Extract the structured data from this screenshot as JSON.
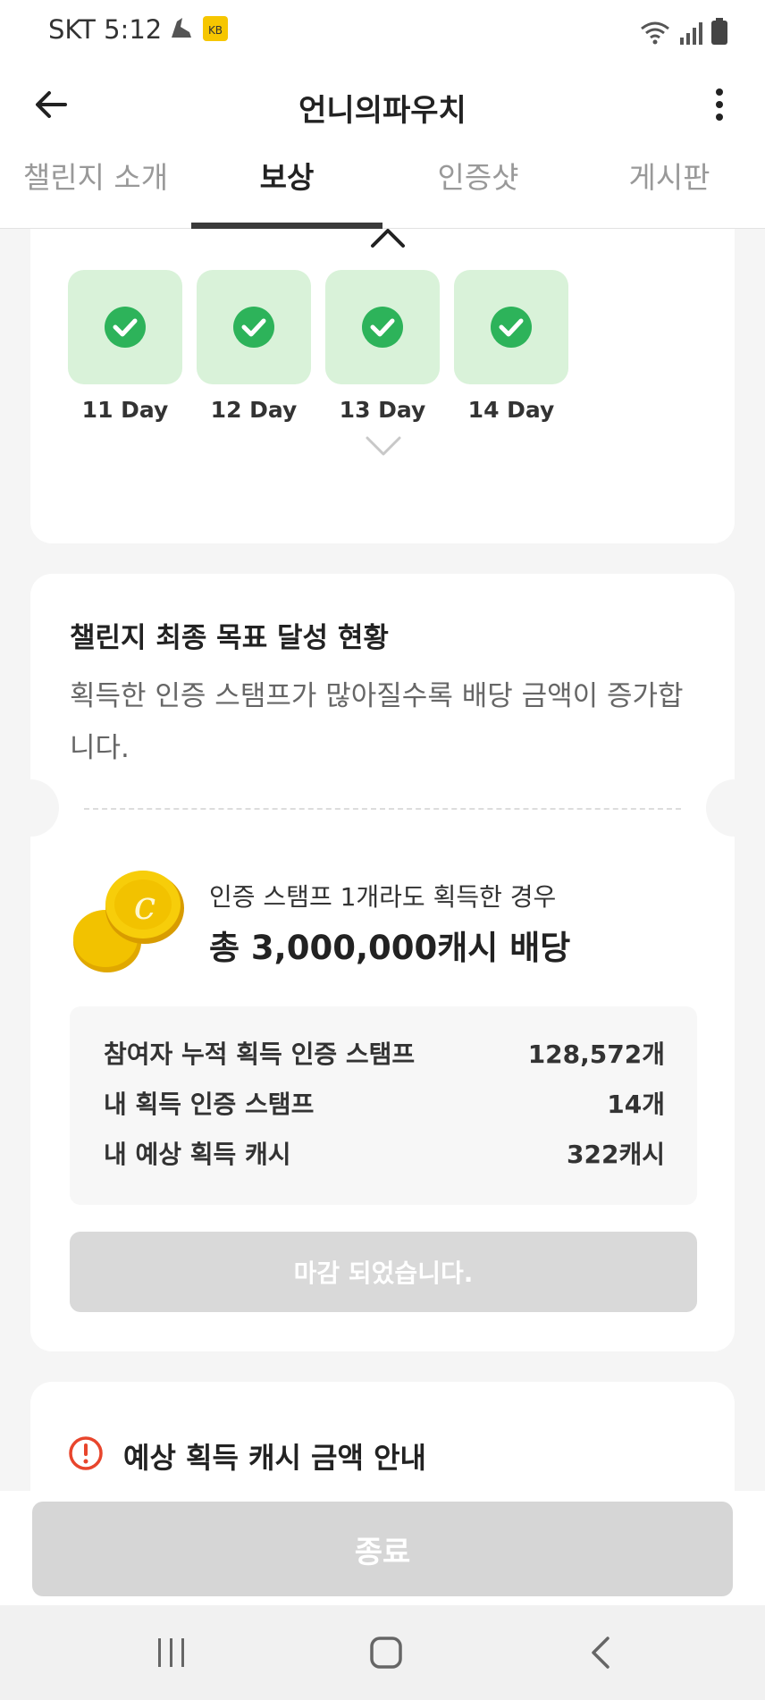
{
  "status_bar": {
    "time": "SKT 5:12",
    "icons": [
      "shoe-icon",
      "kb-app-icon",
      "wifi-icon",
      "signal-icon",
      "battery-icon"
    ]
  },
  "app_bar": {
    "title": "언니의파우치",
    "back_icon": "back-arrow-icon",
    "menu_icon": "more-vert-icon"
  },
  "tabs": [
    {
      "label": "챌린지 소개",
      "active": false
    },
    {
      "label": "보상",
      "active": true
    },
    {
      "label": "인증샷",
      "active": false
    },
    {
      "label": "게시판",
      "active": false
    }
  ],
  "stamps": {
    "days": [
      {
        "label": "11 Day",
        "done": true
      },
      {
        "label": "12 Day",
        "done": true
      },
      {
        "label": "13 Day",
        "done": true
      },
      {
        "label": "14 Day",
        "done": true
      }
    ],
    "done_color": "#2db35a",
    "box_color": "#d9f2d9"
  },
  "goal": {
    "title": "챌린지 최종 목표 달성 현황",
    "description": "획득한 인증 스탬프가 많아질수록 배당 금액이 증가합니다.",
    "reward_condition": "인증 스탬프 1개라도 획득한 경우",
    "reward_amount": "총 3,000,000캐시 배당",
    "stats": [
      {
        "label": "참여자 누적 획득 인증 스탬프",
        "value": "128,572개"
      },
      {
        "label": "내 획득 인증 스탬프",
        "value": "14개"
      },
      {
        "label": "내 예상 획득 캐시",
        "value": "322캐시"
      }
    ],
    "closed_button": "마감 되었습니다."
  },
  "notice": {
    "title": "예상 획득 캐시 금액 안내",
    "icon": "warning-icon"
  },
  "footer": {
    "end_button": "종료"
  },
  "nav_bar": {
    "icons": [
      "recent-apps-icon",
      "home-icon",
      "back-icon"
    ]
  },
  "colors": {
    "coin": "#f2c200",
    "warning": "#e8452c",
    "disabled_button": "#d9d9d9"
  }
}
